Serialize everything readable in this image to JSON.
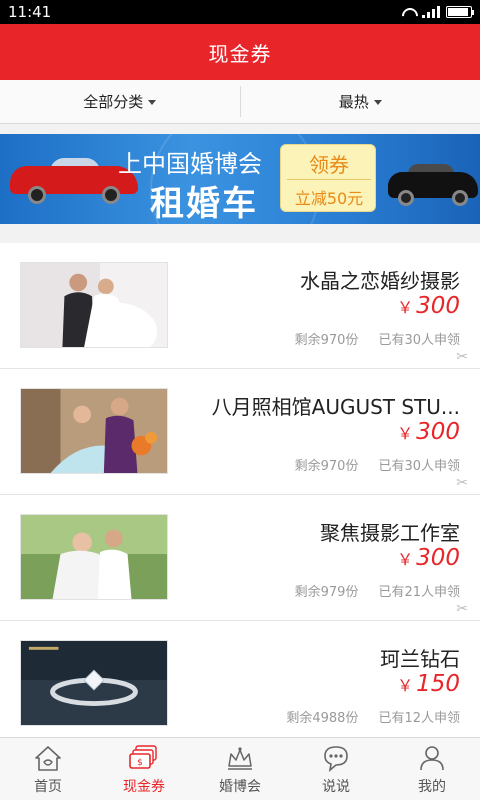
{
  "status": {
    "time": "11:41",
    "battery_level": 0.9
  },
  "header": {
    "title": "现金券"
  },
  "filters": [
    {
      "label": "全部分类"
    },
    {
      "label": "最热"
    }
  ],
  "banner": {
    "line1": "上中国婚博会",
    "line2": "租婚车",
    "coupon_top": "领券",
    "coupon_bottom": "立减50元"
  },
  "currency": "￥",
  "coupons": [
    {
      "title": "水晶之恋婚纱摄影",
      "price": "300",
      "remaining": "剩余970份",
      "claimed": "已有30人申领",
      "image": "wedding-photo"
    },
    {
      "title": "八月照相馆AUGUST  STU...",
      "price": "300",
      "remaining": "剩余970份",
      "claimed": "已有30人申领",
      "image": "wedding-photo"
    },
    {
      "title": "聚焦摄影工作室",
      "price": "300",
      "remaining": "剩余979份",
      "claimed": "已有21人申领",
      "image": "wedding-photo"
    },
    {
      "title": "珂兰钻石",
      "price": "150",
      "remaining": "剩余4988份",
      "claimed": "已有12人申领",
      "image": "diamond-ring"
    }
  ],
  "tabs": [
    {
      "label": "首页",
      "icon": "home-icon"
    },
    {
      "label": "现金券",
      "icon": "cash-coupon-icon",
      "active": true
    },
    {
      "label": "婚博会",
      "icon": "expo-crown-icon"
    },
    {
      "label": "说说",
      "icon": "chat-bubble-icon"
    },
    {
      "label": "我的",
      "icon": "person-icon"
    }
  ],
  "colors": {
    "brand_red": "#e8262a",
    "banner_blue": "#2a7fd4",
    "text_gray": "#9a9a9a"
  }
}
